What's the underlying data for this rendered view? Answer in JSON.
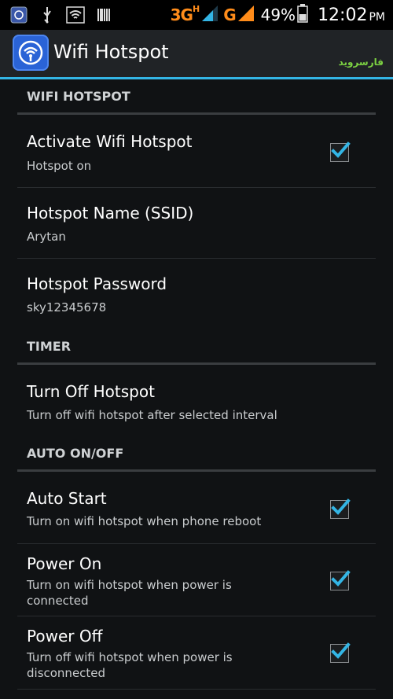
{
  "status": {
    "network_1": "3G",
    "network_1_sup": "H",
    "network_2": "G",
    "battery": "49%",
    "time": "12:02",
    "ampm": "PM"
  },
  "appbar": {
    "title": "Wifi Hotspot",
    "watermark": "فارسروید"
  },
  "sections": {
    "wifi": "WIFI HOTSPOT",
    "timer": "TIMER",
    "auto": "AUTO ON/OFF"
  },
  "items": {
    "activate": {
      "title": "Activate Wifi Hotspot",
      "summary": "Hotspot on",
      "checked": true
    },
    "ssid": {
      "title": "Hotspot Name (SSID)",
      "summary": "Arytan"
    },
    "password": {
      "title": "Hotspot Password",
      "summary": "sky12345678"
    },
    "turnoff": {
      "title": "Turn Off Hotspot",
      "summary": "Turn off wifi hotspot after selected interval"
    },
    "autostart": {
      "title": "Auto Start",
      "summary": "Turn on wifi hotspot when phone reboot",
      "checked": true
    },
    "poweron": {
      "title": "Power On",
      "summary": "Turn on wifi hotspot when power is connected",
      "checked": true
    },
    "poweroff": {
      "title": "Power Off",
      "summary": "Turn off wifi hotspot when power is disconnected",
      "checked": true
    }
  },
  "colors": {
    "accent": "#33b5e5",
    "network": "#ff8c1a"
  }
}
